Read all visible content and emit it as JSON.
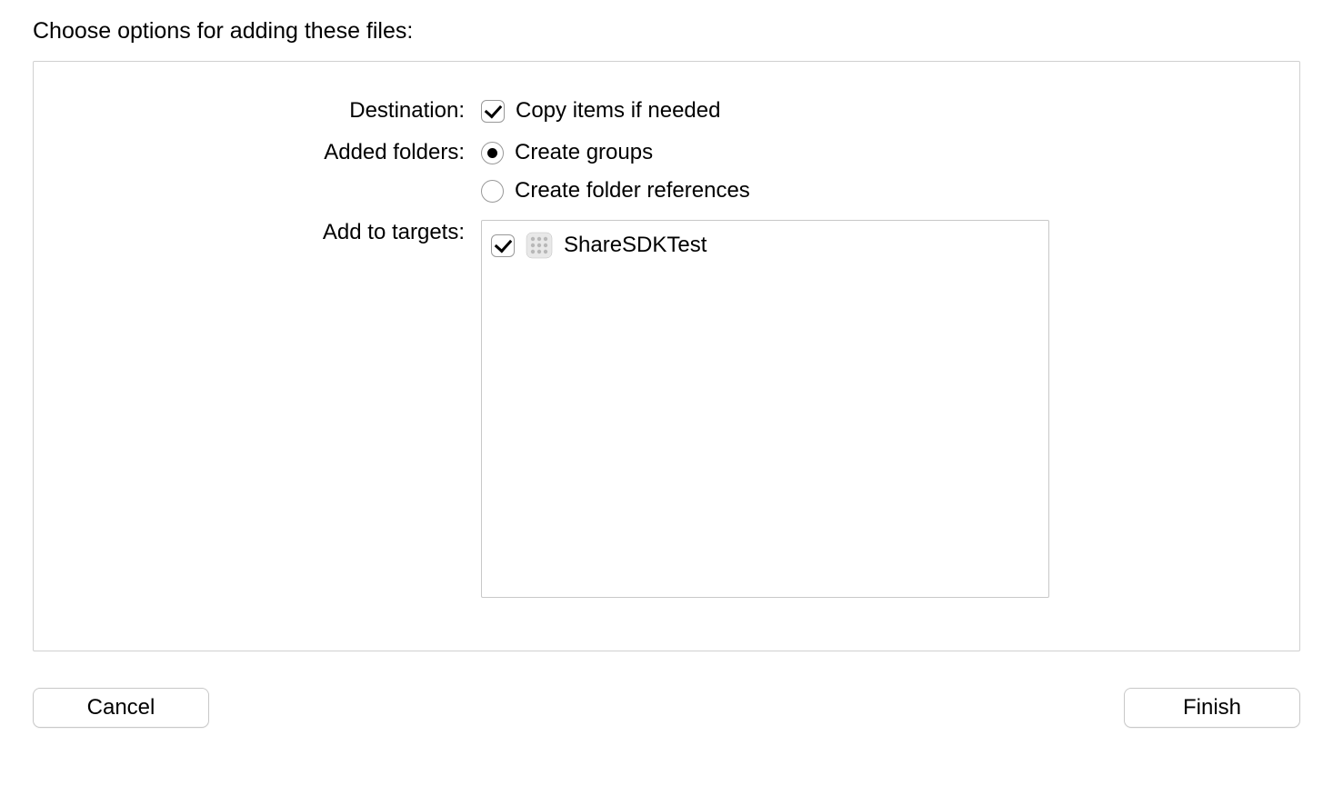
{
  "title": "Choose options for adding these files:",
  "form": {
    "destination": {
      "label": "Destination:",
      "copy_items": {
        "label": "Copy items if needed",
        "checked": true
      }
    },
    "added_folders": {
      "label": "Added folders:",
      "options": {
        "create_groups": "Create groups",
        "create_folder_refs": "Create folder references"
      },
      "selected": "create_groups"
    },
    "add_to_targets": {
      "label": "Add to targets:",
      "targets": [
        {
          "name": "ShareSDKTest",
          "checked": true
        }
      ]
    }
  },
  "buttons": {
    "cancel": "Cancel",
    "finish": "Finish"
  }
}
